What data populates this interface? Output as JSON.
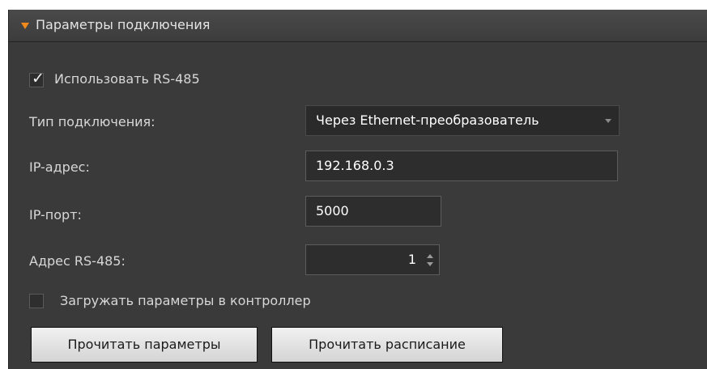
{
  "panel": {
    "title": "Параметры подключения",
    "expanded": true,
    "accent_color": "#f08a1c"
  },
  "use_rs485": {
    "checked": true,
    "label": "Использовать RS-485"
  },
  "connection_type": {
    "label": "Тип подключения:",
    "value": "Через Ethernet-преобразователь"
  },
  "ip_address": {
    "label": "IP-адрес:",
    "value": "192.168.0.3"
  },
  "ip_port": {
    "label": "IP-порт:",
    "value": "5000"
  },
  "rs485_address": {
    "label": "Адрес RS-485:",
    "value": "1"
  },
  "upload_params": {
    "checked": false,
    "label": "Загружать параметры в контроллер"
  },
  "buttons": {
    "read_params": "Прочитать параметры",
    "read_schedule": "Прочитать расписание"
  }
}
